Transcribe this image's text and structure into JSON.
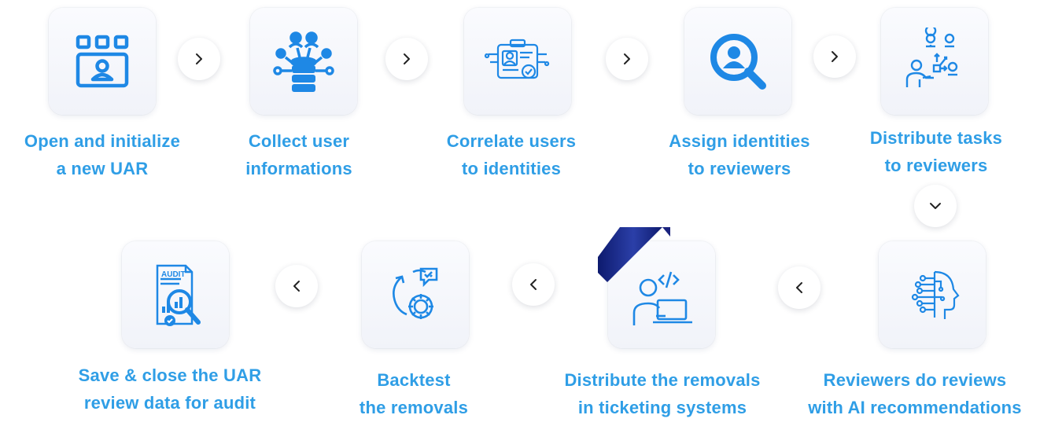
{
  "colors": {
    "accent": "#2f9ee6",
    "icon_stroke": "#1e88e5",
    "ribbon": "#1a237e",
    "card_bg": "#f3f5fa"
  },
  "steps": [
    {
      "line1": "Open and initialize",
      "line2": "a new UAR",
      "icon": "video-grid-icon"
    },
    {
      "line1": "Collect user",
      "line2": "informations",
      "icon": "database-users-icon"
    },
    {
      "line1": "Correlate users",
      "line2": "to identities",
      "icon": "id-card-icon"
    },
    {
      "line1": "Assign identities",
      "line2": "to reviewers",
      "icon": "search-user-icon"
    },
    {
      "line1": "Distribute tasks",
      "line2": "to reviewers",
      "icon": "task-distribution-icon"
    },
    {
      "line1": "Reviewers do reviews",
      "line2": "with AI recommendations",
      "icon": "ai-head-icon"
    },
    {
      "line1": "Distribute the removals",
      "line2": "in ticketing systems",
      "icon": "developer-laptop-icon"
    },
    {
      "line1": "Backtest",
      "line2": "the removals",
      "icon": "backtest-gear-icon"
    },
    {
      "line1": "Save & close the UAR",
      "line2": "review data for audit",
      "icon": "audit-report-icon"
    }
  ],
  "audit_doc_text": "AUDIT",
  "arrows": [
    "chevron-right-icon",
    "chevron-right-icon",
    "chevron-right-icon",
    "chevron-right-icon",
    "chevron-down-icon",
    "chevron-left-icon",
    "chevron-left-icon",
    "chevron-left-icon"
  ]
}
